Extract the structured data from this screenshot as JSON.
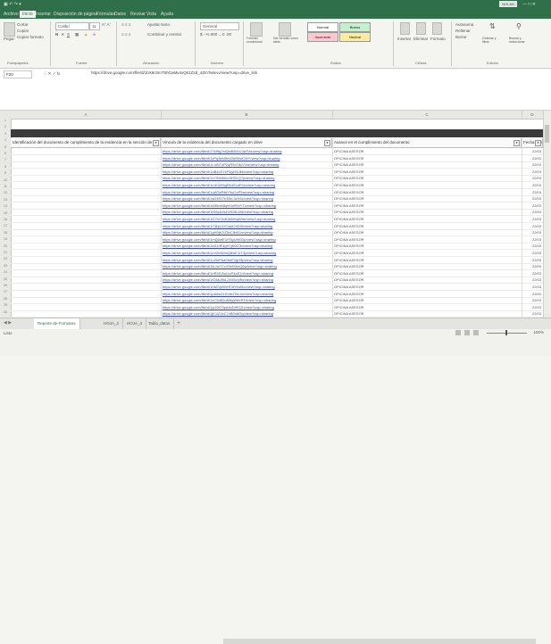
{
  "app": {
    "title": "",
    "user": "NOLAN"
  },
  "menu_tabs": [
    "Archivo",
    "Inicio",
    "Insertar",
    "Disposición de página",
    "Fórmulas",
    "Datos",
    "Revisar",
    "Vista",
    "Ayuda"
  ],
  "ribbon": {
    "clipboard": {
      "paste": "Pegar",
      "cut": "Cortar",
      "copy": "Copiar",
      "format_painter": "Copiar formato",
      "group": "Portapapeles"
    },
    "font": {
      "name": "Calibri",
      "size": "11",
      "group": "Fuente"
    },
    "alignment": {
      "wrap": "Ajustar texto",
      "merge": "Combinar y centrar",
      "group": "Alineación"
    },
    "number": {
      "format": "General",
      "group": "Número"
    },
    "styles": {
      "conditional": "Formato condicional",
      "table": "Dar formato como tabla",
      "swatches": [
        "Normal",
        "Bueno",
        "Incorrecto",
        "Neutral"
      ],
      "group": "Estilos"
    },
    "cells": {
      "insert": "Insertar",
      "delete": "Eliminar",
      "format": "Formato",
      "group": "Celdas"
    },
    "editing": {
      "autosum": "Autosuma",
      "fill": "Rellenar",
      "clear": "Borrar",
      "sort": "Ordenar y filtrar",
      "find": "Buscar y seleccionar",
      "group": "Edición"
    }
  },
  "formula_bar": {
    "name_box": "F20",
    "formula": "https://drive.google.com/file/d/1bX8c0mT5hGaMv4xQk1Z2d_4ZmTwlevv/view?usp=drive_link"
  },
  "columns": [
    "A",
    "B",
    "C",
    "D",
    "E"
  ],
  "table": {
    "headers": [
      "Identificación del documento de cumplimiento de la evidencia en la sección de",
      "Vínculo de la evidencia del documento cargado en drive",
      "Avance en el cumplimiento del documento",
      "Fecha de registro"
    ],
    "rows": [
      {
        "link": "https://drive.google.com/file/d/1Tkf9g2mQwB8XcL0pR4s/view?usp=sharing",
        "status": "OFICINA ASESOR",
        "date": "22/03"
      },
      {
        "link": "https://drive.google.com/file/d/1xPq3kM9nV2bR8wC5tY/view?usp=sharing",
        "status": "OFICINA ASESOR",
        "date": "22/03"
      },
      {
        "link": "https://drive.google.com/file/d/1LmN7oP2qR5sT8uV1w/view?usp=sharing",
        "status": "OFICINA ASESOR",
        "date": "22/03"
      },
      {
        "link": "https://drive.google.com/file/d/1aB4cD7eF0gH3iJ6k/view?usp=sharing",
        "status": "OFICINA ASESOR",
        "date": "22/03"
      },
      {
        "link": "https://drive.google.com/file/d/1zY9xW6vU3tS0rQ7p/view?usp=sharing",
        "status": "OFICINA ASESOR",
        "date": "22/03"
      },
      {
        "link": "https://drive.google.com/file/d/1mK2jH5gF8dS1aP4o/view?usp=sharing",
        "status": "OFICINA ASESOR",
        "date": "22/03"
      },
      {
        "link": "https://drive.google.com/file/d/1qW3eR6tY9uI2oP5a/view?usp=sharing",
        "status": "OFICINA ASESOR",
        "date": "22/03"
      },
      {
        "link": "https://drive.google.com/file/d/1sD4fG7hJ0kL3zX6c/view?usp=sharing",
        "status": "OFICINA ASESOR",
        "date": "22/03"
      },
      {
        "link": "https://drive.google.com/file/d/1vB5nM8qW1eR4tY7u/view?usp=sharing",
        "status": "OFICINA ASESOR",
        "date": "22/03"
      },
      {
        "link": "https://drive.google.com/file/d/1iO6pA9sD2fG5hJ8k/view?usp=sharing",
        "status": "OFICINA ASESOR",
        "date": "22/03"
      },
      {
        "link": "https://drive.google.com/file/d/1lZ7xC0vB3nM6qW9e/view?usp=sharing",
        "status": "OFICINA ASESOR",
        "date": "22/03"
      },
      {
        "link": "https://drive.google.com/file/d/1rT8yU1iO4pA7sD0f/view?usp=sharing",
        "status": "OFICINA ASESOR",
        "date": "22/03"
      },
      {
        "link": "https://drive.google.com/file/d/1gH9jK2lZ5xC8vB1n/view?usp=sharing",
        "status": "OFICINA ASESOR",
        "date": "22/03"
      },
      {
        "link": "https://drive.google.com/file/d/1mQ0wE3rT6yU9iO2p/view?usp=sharing",
        "status": "OFICINA ASESOR",
        "date": "22/03"
      },
      {
        "link": "https://drive.google.com/file/d/1aS1dF4gH7jK0lZ3x/view?usp=sharing",
        "status": "OFICINA ASESOR",
        "date": "22/03"
      },
      {
        "link": "https://drive.google.com/file/d/1cV2bN5mQ8wE1rT4y/view?usp=sharing",
        "status": "OFICINA ASESOR",
        "date": "22/03"
      },
      {
        "link": "https://drive.google.com/file/d/1uI3oP6aS9dF2gH5j/view?usp=sharing",
        "status": "OFICINA ASESOR",
        "date": "22/03"
      },
      {
        "link": "https://drive.google.com/file/d/1kL4zX7cV0bN3mQ6w/view?usp=sharing",
        "status": "OFICINA ASESOR",
        "date": "22/03"
      },
      {
        "link": "https://drive.google.com/file/d/1eR5tY8uI1oP4aS7d/view?usp=sharing",
        "status": "OFICINA ASESOR",
        "date": "22/03"
      },
      {
        "link": "https://drive.google.com/file/d/1fG6hJ9kL2zX5cV8b/view?usp=sharing",
        "status": "OFICINA ASESOR",
        "date": "22/03"
      },
      {
        "link": "https://drive.google.com/file/d/1nM7qW0eR3tY6uI9o/view?usp=sharing",
        "status": "OFICINA ASESOR",
        "date": "22/03"
      },
      {
        "link": "https://drive.google.com/file/d/1pA8sD1fG4hJ7kL0z/view?usp=sharing",
        "status": "OFICINA ASESOR",
        "date": "22/03"
      },
      {
        "link": "https://drive.google.com/file/d/1xC9vB2nM5qW8eR1t/view?usp=sharing",
        "status": "OFICINA ASESOR",
        "date": "22/03"
      },
      {
        "link": "https://drive.google.com/file/d/1yU0iO3pA6sD9fG2h/view?usp=sharing",
        "status": "OFICINA ASESOR",
        "date": "22/03"
      },
      {
        "link": "https://drive.google.com/file/d/1jK1lZ4xC7vB0nM3q/view?usp=sharing",
        "status": "OFICINA ASESOR",
        "date": "22/03"
      }
    ]
  },
  "sheet_tabs": [
    "Reporte de Formatos",
    "HOJA_2",
    "HOJA_3",
    "Tabla_datos"
  ],
  "status_bar": {
    "ready": "Listo",
    "zoom": "100%"
  }
}
